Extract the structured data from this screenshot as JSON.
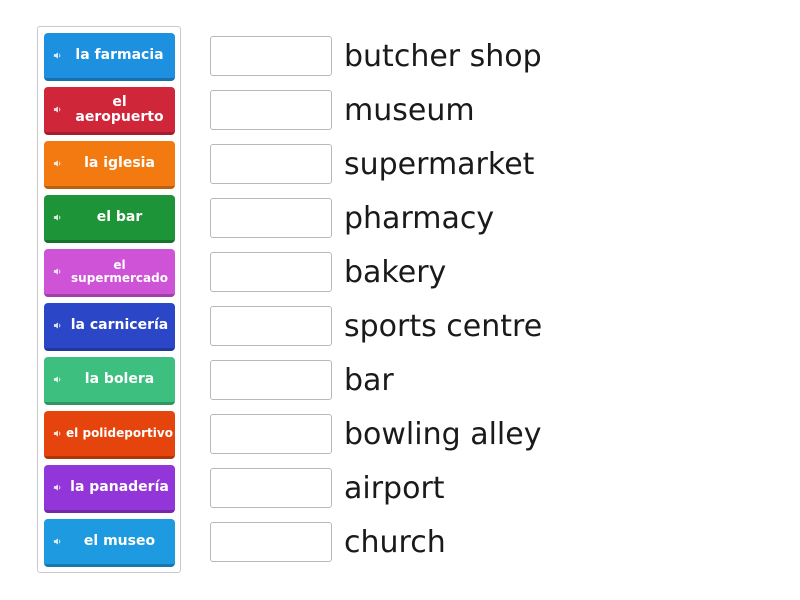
{
  "tiles": [
    {
      "label": "la farmacia",
      "color": "#1e90e0",
      "icon": "speaker-icon"
    },
    {
      "label": "el aeropuerto",
      "color": "#d0263a",
      "icon": "speaker-icon"
    },
    {
      "label": "la iglesia",
      "color": "#f27a10",
      "icon": "speaker-icon"
    },
    {
      "label": "el bar",
      "color": "#1e9438",
      "icon": "speaker-icon"
    },
    {
      "label": "el supermercado",
      "color": "#cf53d6",
      "icon": "speaker-icon"
    },
    {
      "label": "la carnicería",
      "color": "#2b47c7",
      "icon": "speaker-icon"
    },
    {
      "label": "la bolera",
      "color": "#3cbf7f",
      "icon": "speaker-icon"
    },
    {
      "label": "el polideportivo",
      "color": "#e5440c",
      "icon": "speaker-icon"
    },
    {
      "label": "la panadería",
      "color": "#9236d9",
      "icon": "speaker-icon"
    },
    {
      "label": "el museo",
      "color": "#1d9ae0",
      "icon": "speaker-icon"
    }
  ],
  "answers": [
    {
      "text": "butcher shop"
    },
    {
      "text": "museum"
    },
    {
      "text": "supermarket"
    },
    {
      "text": "pharmacy"
    },
    {
      "text": "bakery"
    },
    {
      "text": "sports centre"
    },
    {
      "text": "bar"
    },
    {
      "text": "bowling alley"
    },
    {
      "text": "airport"
    },
    {
      "text": "church"
    }
  ]
}
